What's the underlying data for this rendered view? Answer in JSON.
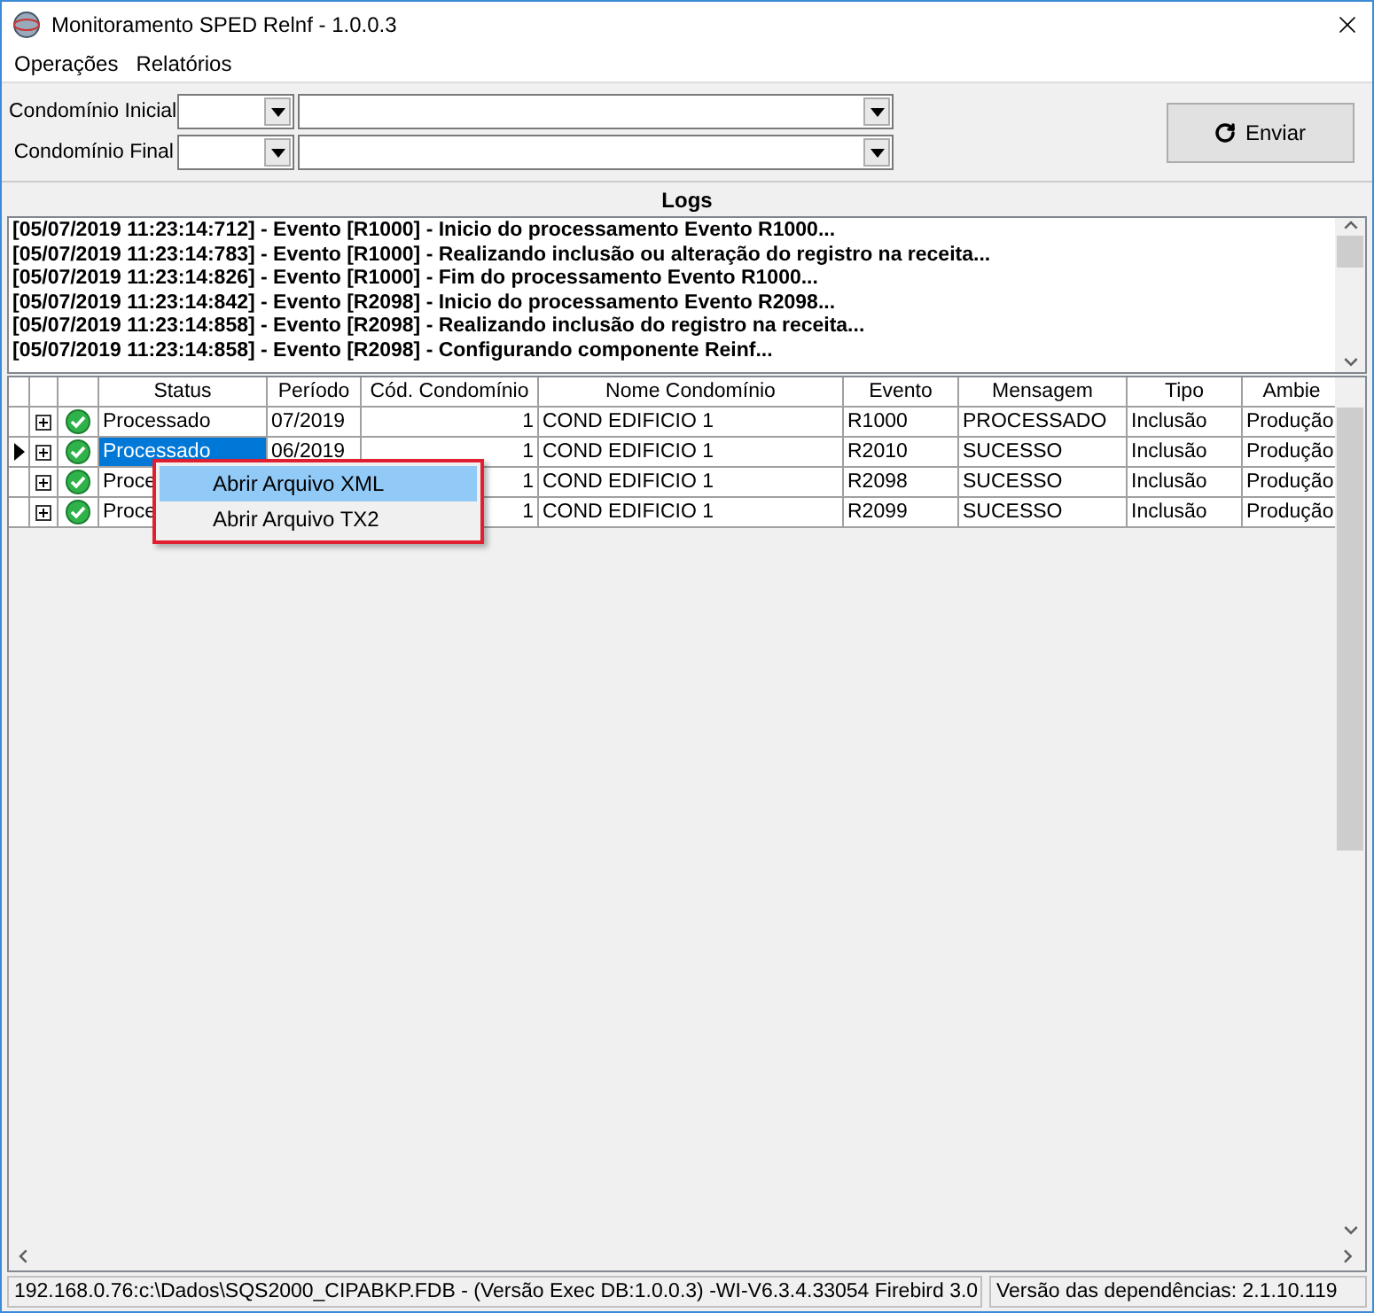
{
  "window": {
    "title": "Monitoramento SPED Relnf - 1.0.0.3"
  },
  "menu": [
    "Operações",
    "Relatórios"
  ],
  "filters": [
    {
      "label": "Condomínio Inicial"
    },
    {
      "label": "Condomínio Final"
    }
  ],
  "send_button": {
    "label": "Enviar"
  },
  "logs": {
    "title": "Logs",
    "lines": [
      "[05/07/2019 11:23:14:712] - Evento [R1000] - Inicio do processamento Evento R1000...",
      "[05/07/2019 11:23:14:783] - Evento [R1000] - Realizando inclusão ou alteração do registro na receita...",
      "[05/07/2019 11:23:14:826] - Evento [R1000] - Fim do processamento Evento R1000...",
      "[05/07/2019 11:23:14:842] - Evento [R2098] - Inicio do processamento Evento R2098...",
      "[05/07/2019 11:23:14:858] - Evento [R2098] - Realizando inclusão do registro na receita...",
      "[05/07/2019 11:23:14:858] - Evento [R2098] - Configurando componente Reinf..."
    ]
  },
  "table": {
    "columns": [
      "Status",
      "Período",
      "Cód. Condomínio",
      "Nome Condomínio",
      "Evento",
      "Mensagem",
      "Tipo",
      "Ambie"
    ],
    "rows": [
      {
        "selected": false,
        "expanded": false,
        "status": "Processado",
        "periodo": "07/2019",
        "codigo": "1",
        "nome": "COND EDIFICIO 1",
        "evento": "R1000",
        "mensagem": "PROCESSADO",
        "tipo": "Inclusão",
        "ambiente": "Produção"
      },
      {
        "selected": true,
        "expanded": false,
        "status": "Processado",
        "periodo": "06/2019",
        "codigo": "1",
        "nome": "COND EDIFICIO 1",
        "evento": "R2010",
        "mensagem": "SUCESSO",
        "tipo": "Inclusão",
        "ambiente": "Produção"
      },
      {
        "selected": false,
        "expanded": false,
        "status": "Proce",
        "codigo": "1",
        "nome": "COND EDIFICIO 1",
        "evento": "R2098",
        "mensagem": "SUCESSO",
        "tipo": "Inclusão",
        "ambiente": "Produção"
      },
      {
        "selected": false,
        "expanded": false,
        "status": "Proce",
        "codigo": "1",
        "nome": "COND EDIFICIO 1",
        "evento": "R2099",
        "mensagem": "SUCESSO",
        "tipo": "Inclusão",
        "ambiente": "Produção"
      }
    ]
  },
  "context_menu": [
    {
      "label": "Abrir Arquivo XML",
      "selected": true
    },
    {
      "label": "Abrir Arquivo TX2",
      "selected": false
    }
  ],
  "status_bar": [
    "192.168.0.76:c:\\Dados\\SQS2000_CIPABKP.FDB - (Versão Exec DB:1.0.0.3) -WI-V6.3.4.33054 Firebird 3.0",
    "Versão das dependências: 2.1.10.119"
  ]
}
